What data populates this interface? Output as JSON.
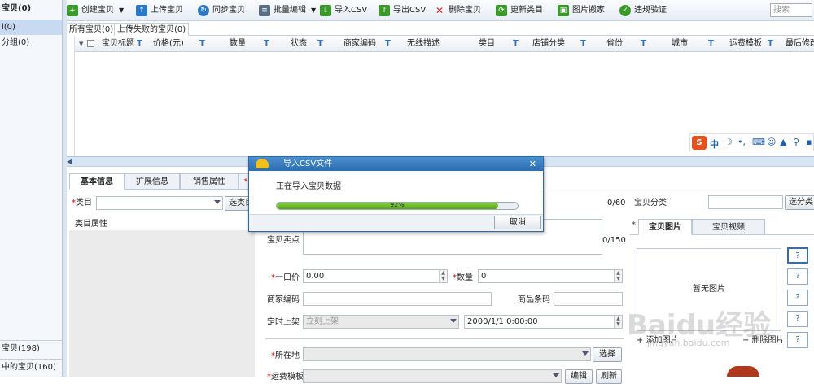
{
  "left_panel": {
    "items": [
      "宝贝(0)",
      "l(0)",
      "分组(0)"
    ],
    "bottom_items": [
      "宝贝(198)",
      "中的宝贝(160)"
    ]
  },
  "toolbar": {
    "buttons": [
      {
        "label": "创建宝贝",
        "icon": "plus-icon",
        "color": "#3a9a2a"
      },
      {
        "label": "上传宝贝",
        "icon": "upload-icon",
        "color": "#2a79c8"
      },
      {
        "label": "同步宝贝",
        "icon": "sync-icon",
        "color": "#2a79c8"
      },
      {
        "label": "批量编辑",
        "icon": "batch-edit-icon",
        "color": "#5a6f86"
      },
      {
        "label": "导入CSV",
        "icon": "import-csv-icon",
        "color": "#3a9a2a"
      },
      {
        "label": "导出CSV",
        "icon": "export-csv-icon",
        "color": "#3a9a2a"
      },
      {
        "label": "删除宝贝",
        "icon": "delete-icon",
        "color": "#d22"
      },
      {
        "label": "更新类目",
        "icon": "refresh-category-icon",
        "color": "#3a9a2a"
      },
      {
        "label": "图片搬家",
        "icon": "image-move-icon",
        "color": "#3a9a2a"
      },
      {
        "label": "违规验证",
        "icon": "verify-icon",
        "color": "#3a9a2a"
      }
    ],
    "search_placeholder": "搜索"
  },
  "top_tabs": [
    "所有宝贝(0)",
    "上传失败的宝贝(0)"
  ],
  "grid_columns": [
    "宝贝标题",
    "价格(元)",
    "数量",
    "状态",
    "商家编码",
    "无线描述",
    "类目",
    "店铺分类",
    "省份",
    "城市",
    "运费模板",
    "最后修改"
  ],
  "detail_tabs": [
    "基本信息",
    "扩展信息",
    "销售属性",
    "*"
  ],
  "form": {
    "category_label": "类目",
    "select_category_btn": "选类目",
    "category_props_label": "类目属性",
    "title_counter": "0/60",
    "selling_point_label": "宝贝卖点",
    "selling_counter": "0/150",
    "price_label": "一口价",
    "price_value": "0.00",
    "qty_label": "数量",
    "qty_value": "0",
    "merchant_code_label": "商家编码",
    "barcode_label": "商品条码",
    "schedule_label": "定时上架",
    "schedule_value": "立刻上架",
    "datetime_value": "2000/1/1 0:00:00",
    "location_label": "所在地",
    "choose_btn": "选择",
    "shipping_label": "运费模板",
    "edit_btn": "编辑",
    "refresh_btn": "刷新",
    "shop_category_label": "宝贝分类",
    "select_shop_category_btn": "选分类"
  },
  "images_panel": {
    "tabs": [
      "宝贝图片",
      "宝贝视频"
    ],
    "placeholder": "暂无图片",
    "add_label": "添加图片",
    "remove_label": "删除图片",
    "slot_label": "?"
  },
  "dialog": {
    "title": "导入CSV文件",
    "message": "正在导入宝贝数据",
    "progress": 0.92,
    "progress_label": "92%",
    "cancel_label": "取消"
  },
  "ime_bar": {
    "logo": "S",
    "mode": "中"
  },
  "watermark": {
    "text": "Baidu经验",
    "url": "jingyan.baidu.com"
  }
}
